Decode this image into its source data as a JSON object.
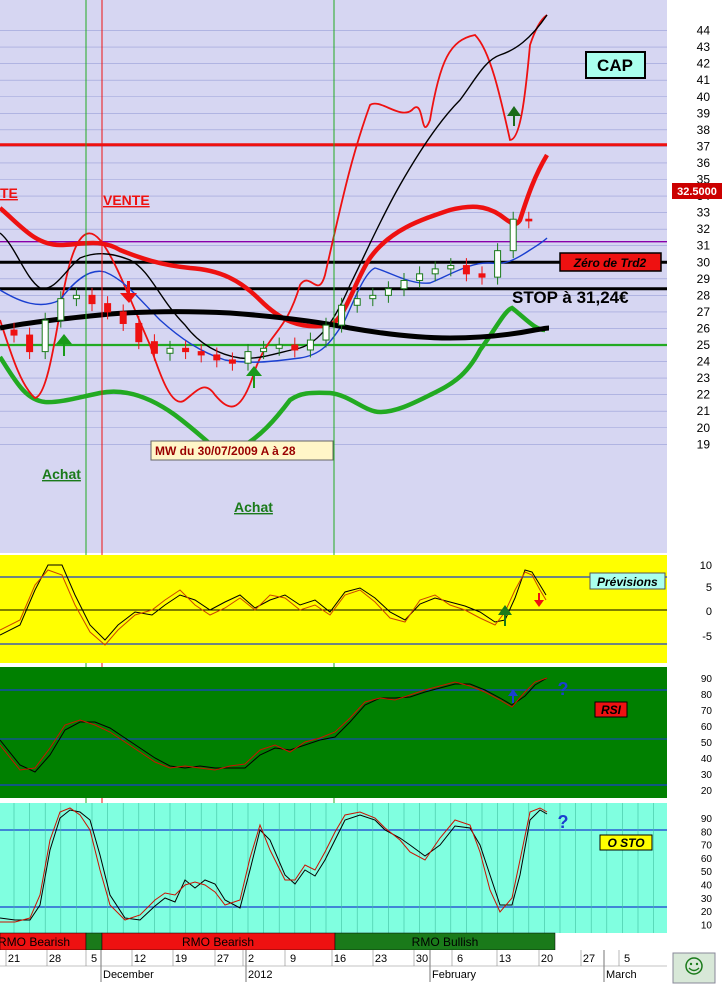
{
  "ticker": "CAP",
  "price_tag": "32.5000",
  "annotations": {
    "vente_left": "TE",
    "vente": "VENTE",
    "zero_trd2": "Zéro de Trd2",
    "stop": "STOP à 31,24€",
    "mw_note": "MW du 30/07/2009   A à 28",
    "achat_1": "Achat",
    "achat_2": "Achat"
  },
  "panels": {
    "previsions": "Prévisions",
    "rsi": "RSI",
    "osto": "O STO",
    "question": "?"
  },
  "rmo_bar": [
    {
      "label": "RMO Bearish",
      "color": "#ee1111"
    },
    {
      "label": "RMO Bearish",
      "color": "#ee1111"
    },
    {
      "label": "RMO Bullish",
      "color": "#1a7a1a"
    }
  ],
  "colors": {
    "main_bg": "#d6d6f2",
    "prev_bg": "#ffff00",
    "rsi_bg": "#008000",
    "osto_bg": "#80ffe0",
    "candle_up": "#1a7a1a",
    "candle_down": "#ee1111",
    "upper_band": "#ee1111",
    "lower_band": "#22aa22"
  },
  "chart_data": [
    {
      "type": "candlestick",
      "title": "CAP",
      "x_ticks": [
        "21",
        "28",
        "5",
        "12",
        "19",
        "27",
        "2",
        "9",
        "16",
        "23",
        "30",
        "6",
        "13",
        "20",
        "27",
        "5"
      ],
      "x_month_labels": [
        "December",
        "2012",
        "February",
        "March"
      ],
      "y_ticks": [
        19,
        20,
        21,
        22,
        23,
        24,
        25,
        26,
        27,
        28,
        29,
        30,
        31,
        32,
        33,
        34,
        35,
        36,
        37,
        38,
        39,
        40,
        41,
        42,
        43,
        44
      ],
      "ylim": [
        18.5,
        44
      ],
      "last_price": 32.5,
      "horizontal_levels": [
        {
          "value": 37.1,
          "color": "#ee1111"
        },
        {
          "value": 31.24,
          "color": "#8800aa"
        },
        {
          "value": 30.0,
          "color": "#000000"
        },
        {
          "value": 28.4,
          "color": "#000000"
        },
        {
          "value": 25.0,
          "color": "#22aa22"
        }
      ],
      "series": [
        {
          "name": "close",
          "values": [
            25.6,
            24.6,
            26.5,
            27.8,
            28.0,
            27.5,
            27.0,
            26.3,
            25.2,
            24.5,
            24.8,
            24.6,
            24.4,
            24.1,
            23.9,
            24.6,
            24.8,
            25.0,
            24.7,
            25.3,
            26.2,
            27.4,
            27.8,
            28.0,
            28.4,
            28.9,
            29.3,
            29.6,
            29.8,
            29.3,
            29.1,
            30.7,
            32.6,
            32.5
          ]
        }
      ]
    },
    {
      "type": "line",
      "title": "Prévisions",
      "y_ticks": [
        10,
        5,
        0,
        -5
      ],
      "ylim": [
        -9,
        11
      ],
      "series": [
        {
          "name": "",
          "values": [
            -6,
            -5,
            0,
            7,
            10,
            2,
            -6,
            -6,
            -3,
            -1,
            0,
            -1,
            1,
            1,
            4,
            3,
            2,
            -1,
            3,
            1,
            -2,
            1,
            3,
            4,
            3,
            1,
            -2,
            -3,
            0,
            2,
            0,
            -3,
            -3,
            2,
            9,
            5
          ]
        }
      ]
    },
    {
      "type": "line",
      "title": "RSI",
      "y_ticks": [
        90,
        80,
        70,
        60,
        50,
        40,
        30,
        20
      ],
      "ylim": [
        10,
        95
      ],
      "series": [
        {
          "name": "",
          "values": [
            35,
            31,
            38,
            52,
            60,
            61,
            57,
            50,
            45,
            38,
            35,
            33,
            34,
            32,
            32,
            36,
            42,
            45,
            41,
            46,
            48,
            52,
            65,
            74,
            76,
            77,
            80,
            83,
            86,
            85,
            78,
            73,
            84,
            90
          ]
        }
      ]
    },
    {
      "type": "line",
      "title": "O STO",
      "y_ticks": [
        90,
        80,
        70,
        60,
        50,
        40,
        30,
        20,
        10
      ],
      "ylim": [
        0,
        100
      ],
      "series": [
        {
          "name": "",
          "values": [
            10,
            9,
            50,
            93,
            90,
            55,
            15,
            10,
            10,
            18,
            40,
            22,
            35,
            38,
            20,
            72,
            82,
            50,
            62,
            90,
            96,
            90,
            84,
            62,
            78,
            84,
            76,
            18,
            20,
            90,
            95
          ]
        }
      ]
    }
  ]
}
